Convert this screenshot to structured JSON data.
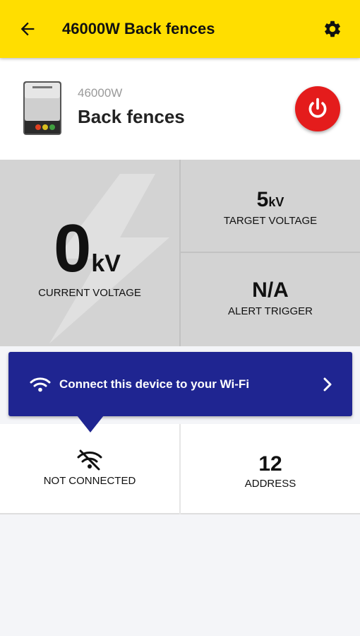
{
  "header": {
    "title": "46000W Back fences",
    "back_icon": "arrow-left-icon",
    "settings_icon": "gear-icon"
  },
  "device": {
    "model": "46000W",
    "name": "Back fences",
    "power_icon": "power-icon",
    "power_color": "#e41c1c"
  },
  "stats": {
    "current_voltage": {
      "value": "0",
      "unit": "kV",
      "label": "CURRENT VOLTAGE"
    },
    "target_voltage": {
      "value": "5",
      "unit": "kV",
      "label": "TARGET VOLTAGE"
    },
    "alert_trigger": {
      "value": "N/A",
      "label": "ALERT TRIGGER"
    }
  },
  "wifi_banner": {
    "text": "Connect this device to your Wi-Fi",
    "icon": "wifi-icon",
    "color": "#1f2591"
  },
  "connection": {
    "status": "NOT CONNECTED",
    "icon": "wifi-off-icon"
  },
  "address": {
    "value": "12",
    "label": "ADDRESS"
  },
  "colors": {
    "appbar": "#ffde00",
    "panel": "#d3d3d3"
  }
}
